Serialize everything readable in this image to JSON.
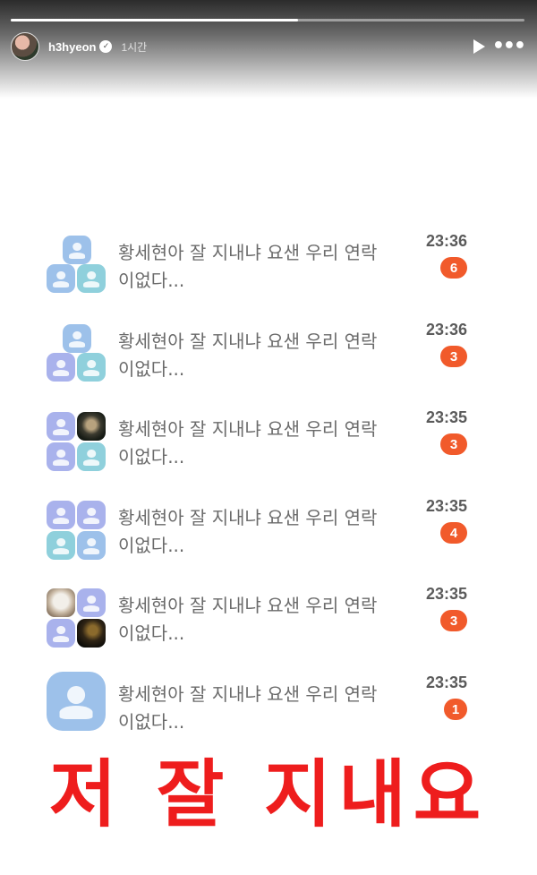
{
  "story": {
    "username": "h3hyeon",
    "posted_ago": "1시간",
    "progress": 0.56,
    "verified_icon": "verified-badge-icon",
    "play_icon": "play-icon",
    "more_icon": "more-options-icon"
  },
  "chats": [
    {
      "preview": "황세현아 잘 지내냐 요샌 우리 연락이없다...",
      "time": "23:36",
      "unread": "6",
      "avatar": "group-avatar-3"
    },
    {
      "preview": "황세현아 잘 지내냐 요샌 우리 연락이없다...",
      "time": "23:36",
      "unread": "3",
      "avatar": "group-avatar-3"
    },
    {
      "preview": "황세현아 잘 지내냐 요샌 우리 연락이없다...",
      "time": "23:35",
      "unread": "3",
      "avatar": "group-avatar-4"
    },
    {
      "preview": "황세현아 잘 지내냐 요샌 우리 연락이없다...",
      "time": "23:35",
      "unread": "4",
      "avatar": "group-avatar-4"
    },
    {
      "preview": "황세현아 잘 지내냐 요샌 우리 연락이없다...",
      "time": "23:35",
      "unread": "3",
      "avatar": "group-avatar-4"
    },
    {
      "preview": "황세현아 잘 지내냐 요샌 우리 연락이없다...",
      "time": "23:35",
      "unread": "1",
      "avatar": "single-avatar"
    }
  ],
  "caption": "저 잘 지내요",
  "colors": {
    "badge": "#f15a2b",
    "caption": "#ee1d1d"
  }
}
